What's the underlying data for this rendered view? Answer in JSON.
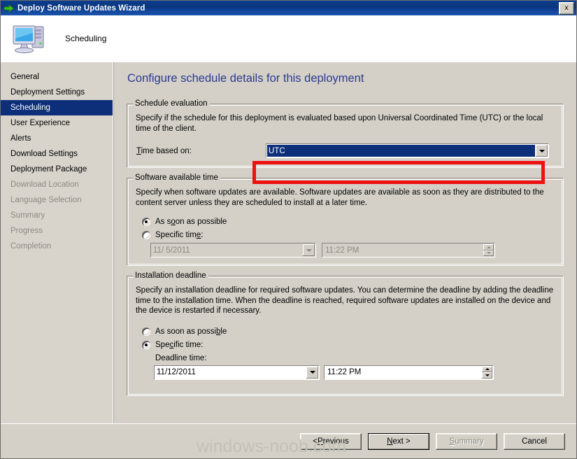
{
  "window": {
    "title": "Deploy Software Updates Wizard",
    "title_icon": "green-arrow-icon",
    "close_label": "x",
    "titlebar_color": "#0b3e8f"
  },
  "banner": {
    "icon": "computer-icon",
    "title": "Scheduling"
  },
  "sidebar": {
    "items": [
      {
        "label": "General",
        "state": "normal"
      },
      {
        "label": "Deployment Settings",
        "state": "normal"
      },
      {
        "label": "Scheduling",
        "state": "selected"
      },
      {
        "label": "User Experience",
        "state": "normal"
      },
      {
        "label": "Alerts",
        "state": "normal"
      },
      {
        "label": "Download Settings",
        "state": "normal"
      },
      {
        "label": "Deployment Package",
        "state": "normal"
      },
      {
        "label": "Download Location",
        "state": "disabled"
      },
      {
        "label": "Language Selection",
        "state": "disabled"
      },
      {
        "label": "Summary",
        "state": "disabled"
      },
      {
        "label": "Progress",
        "state": "disabled"
      },
      {
        "label": "Completion",
        "state": "disabled"
      }
    ],
    "selected_color": "#0d2f7a"
  },
  "main": {
    "heading": "Configure schedule details for this deployment",
    "heading_color": "#2b3a8f",
    "schedule_evaluation": {
      "title": "Schedule evaluation",
      "description": "Specify if the schedule for this deployment is evaluated based upon Universal Coordinated Time (UTC) or the local time of the client.",
      "time_based_on_label": "Time based on:",
      "time_based_on_value": "UTC",
      "highlight_color": "#ee1111"
    },
    "software_available_time": {
      "title": "Software available time",
      "description": "Specify when software updates are available. Software updates are available as soon as they are distributed to the content server unless they are scheduled to install at a later time.",
      "option_asap_label": "As soon as possible",
      "option_specific_label": "Specific time:",
      "selected_option": "asap",
      "date_value": "11/ 5/2011",
      "time_value": "11:22 PM",
      "fields_enabled": false
    },
    "installation_deadline": {
      "title": "Installation deadline",
      "description": "Specify an installation deadline for required software updates. You can determine the deadline by adding the deadline time to the installation time. When the deadline is reached, required software updates are installed on the device and the device is restarted if necessary.",
      "option_asap_label": "As soon as possible",
      "option_specific_label": "Specific time:",
      "selected_option": "specific",
      "deadline_time_label": "Deadline time:",
      "date_value": "11/12/2011",
      "time_value": "11:22 PM",
      "fields_enabled": true
    }
  },
  "footer": {
    "previous_label": "< Previous",
    "next_label": "Next >",
    "summary_label": "Summary",
    "cancel_label": "Cancel",
    "summary_disabled": true,
    "default_button": "next"
  },
  "watermark": "windows-noob.com"
}
